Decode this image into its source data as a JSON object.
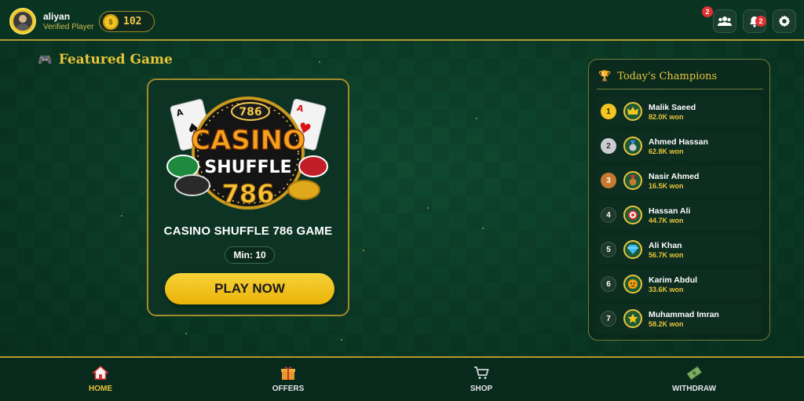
{
  "header": {
    "username": "aliyan",
    "user_status": "Verified Player",
    "coins": "102",
    "friends_badge": "2",
    "notifications_badge": "2"
  },
  "featured": {
    "title": "Featured Game",
    "game_name": "CASINO SHUFFLE 786 GAME",
    "min_bet": "Min: 10",
    "play_label": "PLAY NOW",
    "logo_text": {
      "badge": "786",
      "word1": "CASINO",
      "word2": "SHUFFLE",
      "number": "786"
    }
  },
  "champions": {
    "title": "Today's Champions",
    "items": [
      {
        "rank": "1",
        "name": "Malik Saeed",
        "won": "82.0K won",
        "icon": "crown-icon"
      },
      {
        "rank": "2",
        "name": "Ahmed Hassan",
        "won": "62.8K won",
        "icon": "medal-icon"
      },
      {
        "rank": "3",
        "name": "Nasir Ahmed",
        "won": "16.5K won",
        "icon": "medal-icon"
      },
      {
        "rank": "4",
        "name": "Hassan Ali",
        "won": "44.7K won",
        "icon": "target-icon"
      },
      {
        "rank": "5",
        "name": "Ali Khan",
        "won": "56.7K won",
        "icon": "diamond-icon"
      },
      {
        "rank": "6",
        "name": "Karim Abdul",
        "won": "33.6K won",
        "icon": "tiger-icon"
      },
      {
        "rank": "7",
        "name": "Muhammad Imran",
        "won": "58.2K won",
        "icon": "star-icon"
      }
    ]
  },
  "nav": {
    "items": [
      {
        "label": "HOME",
        "icon": "home-icon",
        "active": true
      },
      {
        "label": "OFFERS",
        "icon": "gift-icon",
        "active": false
      },
      {
        "label": "SHOP",
        "icon": "cart-icon",
        "active": false
      },
      {
        "label": "WITHDRAW",
        "icon": "money-icon",
        "active": false
      }
    ]
  },
  "colors": {
    "accent": "#e8c53a",
    "background": "#0b3a26",
    "play_button": "#f2c51f",
    "badge": "#e03131"
  }
}
